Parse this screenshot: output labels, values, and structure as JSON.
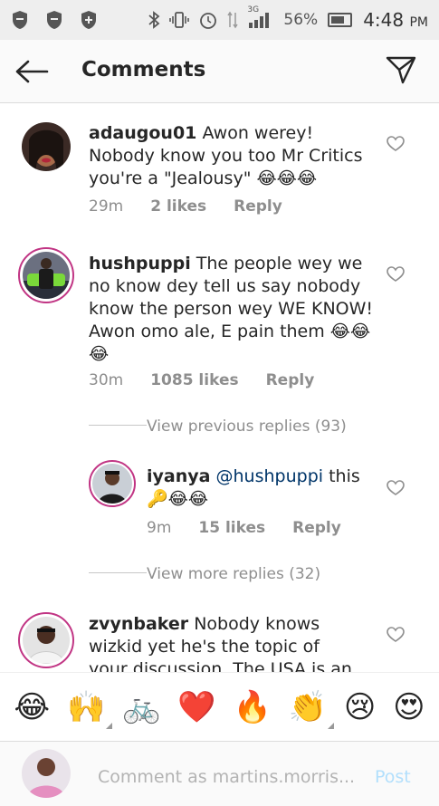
{
  "statusbar": {
    "battery": "56%",
    "network": "3G",
    "time": "4:48",
    "ampm": "PM"
  },
  "header": {
    "title": "Comments"
  },
  "comments": [
    {
      "username": "adaugou01",
      "text": "Awon werey! Nobody know you too Mr Critics you're a \"Jealousy\" 😂😂😂",
      "time": "29m",
      "likes": "2 likes",
      "reply": "Reply"
    },
    {
      "username": "hushpuppi",
      "text": "The people wey we no know dey tell us say nobody know the person wey WE KNOW! Awon omo ale, E pain them 😂😂😂",
      "time": "30m",
      "likes": "1085 likes",
      "reply": "Reply",
      "view_previous": "View previous replies (93)",
      "view_more": "View more replies (32)"
    },
    {
      "username": "iyanya",
      "mention": "@hushpuppi",
      "text": "this 🔑😂😂",
      "time": "9m",
      "likes": "15 likes",
      "reply": "Reply"
    },
    {
      "username": "zvynbaker",
      "text": "Nobody knows wizkid yet he's the topic of your discussion. The USA is an"
    }
  ],
  "emoji_bar": [
    "😂",
    "🙌",
    "🚲",
    "❤️",
    "🔥",
    "👏",
    "😢",
    "😍"
  ],
  "composer": {
    "placeholder": "Comment as martins.morris...",
    "post_label": "Post"
  },
  "colors": {
    "ring": "#c13584",
    "post_disabled": "#b2dffc",
    "mention": "#003569",
    "meta_gray": "#8e8e8e"
  }
}
